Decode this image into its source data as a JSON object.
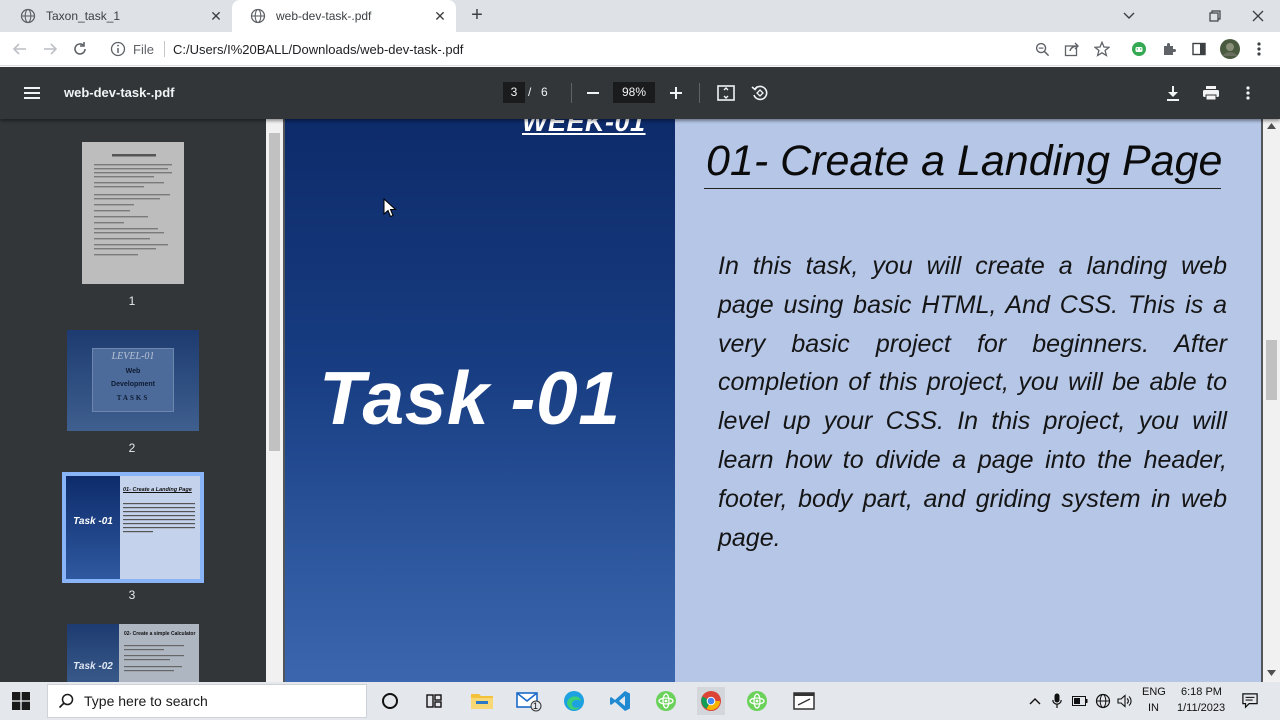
{
  "browser": {
    "tabs": [
      {
        "title": "Taxon_task_1",
        "active": false
      },
      {
        "title": "web-dev-task-.pdf",
        "active": true
      }
    ],
    "address": {
      "scheme_label": "File",
      "url": "C:/Users/I%20BALL/Downloads/web-dev-task-.pdf"
    }
  },
  "pdf_viewer": {
    "file_name": "web-dev-task-.pdf",
    "current_page": "3",
    "page_separator": "/",
    "total_pages": "6",
    "zoom": "98%",
    "thumbnails": [
      {
        "number": "1",
        "selected": false
      },
      {
        "number": "2",
        "selected": false,
        "text": [
          "LEVEL-01",
          "Web",
          "Development",
          "TASKS"
        ]
      },
      {
        "number": "3",
        "selected": true,
        "text": [
          "Task -01",
          "01- Create a Landing Page"
        ]
      },
      {
        "number": "",
        "selected": false,
        "text": [
          "Task -02",
          "02- Create a simple Calculator"
        ]
      }
    ]
  },
  "document": {
    "week_label": "WEEK-01",
    "task_label": "Task -01",
    "heading": "01- Create a Landing Page",
    "body": "In this task, you will create a landing web page using basic HTML, And CSS. This is a very basic project for beginners. After completion of this project, you will be able to level up your CSS. In this project, you will learn how to divide a page into the header, footer, body part, and griding system in web page."
  },
  "taskbar": {
    "search_placeholder": "Type here to search",
    "mail_badge": "1",
    "language": "ENG",
    "region": "IN",
    "time": "6:18 PM",
    "date": "1/11/2023"
  },
  "colors": {
    "pdf_toolbar": "#323639",
    "slide_blue": "#183d82",
    "slide_light": "#b5c6e7",
    "selected_thumb": "#8ab4f8"
  }
}
